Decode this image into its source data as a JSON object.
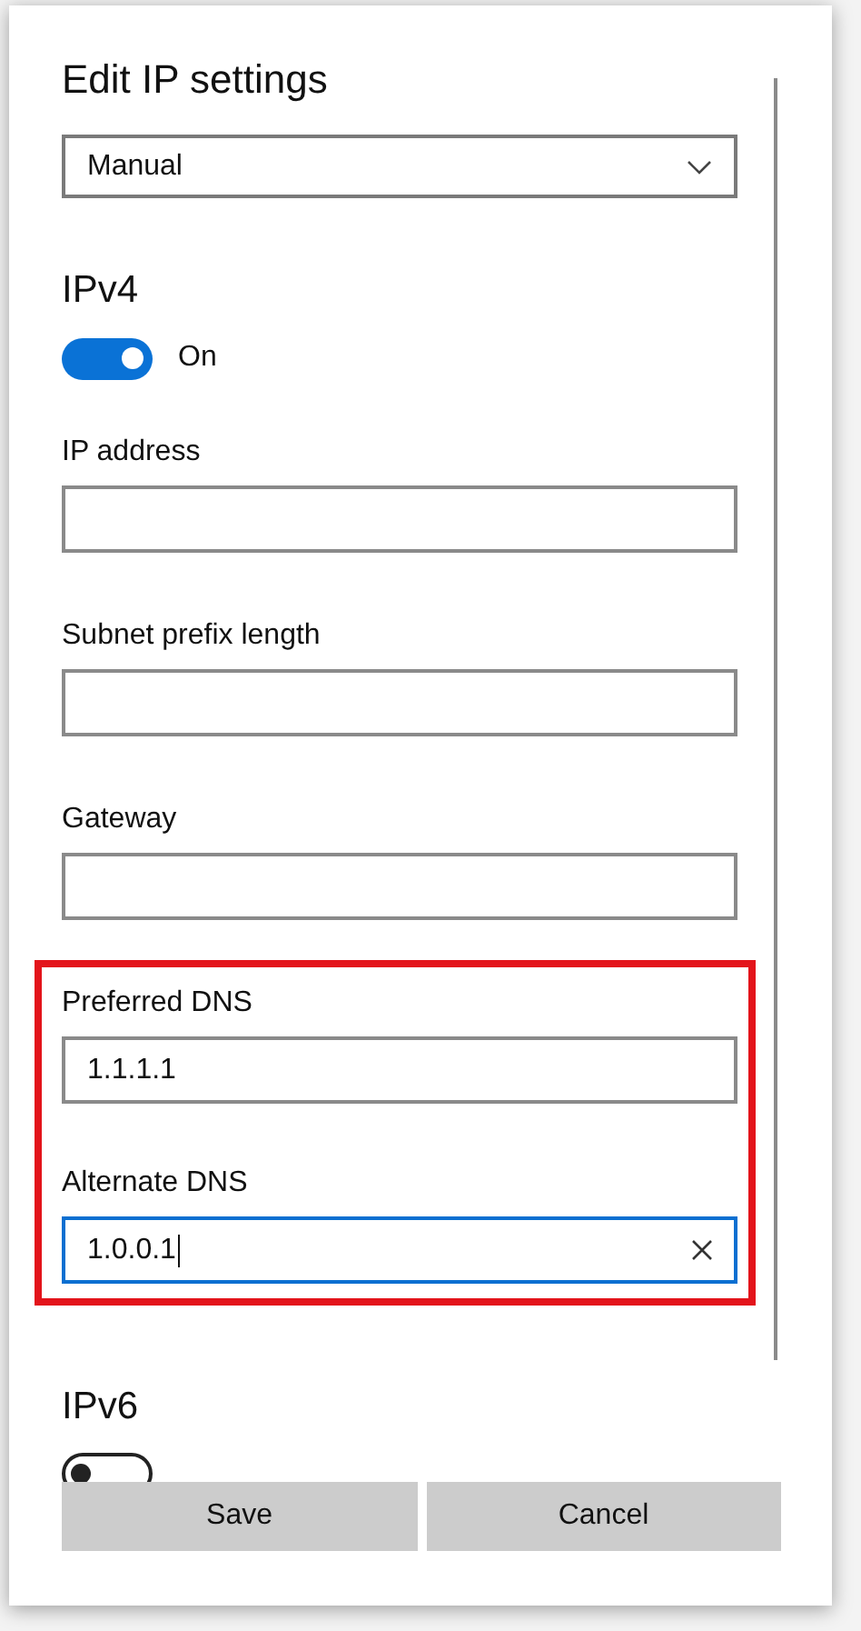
{
  "dialog": {
    "title": "Edit IP settings",
    "mode_dropdown": {
      "value": "Manual"
    }
  },
  "ipv4": {
    "heading": "IPv4",
    "toggle": {
      "on": true,
      "label": "On"
    },
    "fields": [
      {
        "label": "IP address",
        "focused": false,
        "highlighted": false
      },
      {
        "label": "Subnet prefix length",
        "focused": false,
        "highlighted": false
      },
      {
        "label": "Gateway",
        "focused": false,
        "highlighted": false
      },
      {
        "label": "Preferred DNS",
        "value": "1.1.1.1",
        "focused": false,
        "highlighted": true
      },
      {
        "label": "Alternate DNS",
        "value": "1.0.0.1",
        "focused": true,
        "highlighted": true
      }
    ]
  },
  "ipv6": {
    "heading": "IPv6",
    "toggle": {
      "on": false
    }
  },
  "buttons": [
    "Save",
    "Cancel"
  ]
}
